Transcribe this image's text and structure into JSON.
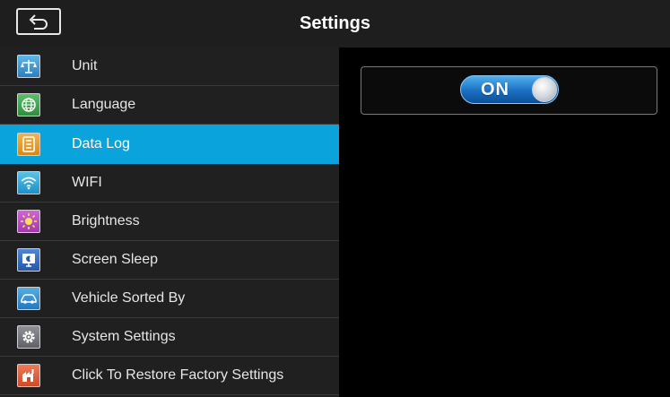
{
  "header": {
    "title": "Settings"
  },
  "menu": [
    {
      "label": "Unit",
      "icon": "scale-icon"
    },
    {
      "label": "Language",
      "icon": "globe-icon"
    },
    {
      "label": "Data Log",
      "icon": "data-log-icon",
      "active": true
    },
    {
      "label": "WIFI",
      "icon": "wifi-icon"
    },
    {
      "label": "Brightness",
      "icon": "brightness-icon"
    },
    {
      "label": "Screen Sleep",
      "icon": "screen-sleep-icon"
    },
    {
      "label": "Vehicle Sorted By",
      "icon": "vehicle-icon"
    },
    {
      "label": "System Settings",
      "icon": "gear-icon"
    },
    {
      "label": "Click To Restore Factory Settings",
      "icon": "factory-reset-icon"
    }
  ],
  "detail": {
    "toggle_label": "ON",
    "toggle_state": true
  },
  "colors": {
    "active": "#0aa3dc",
    "toggle": "#1a6fc0"
  }
}
